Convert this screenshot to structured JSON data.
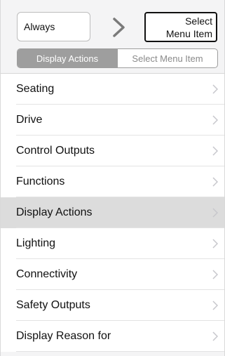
{
  "header": {
    "source_value": "Always",
    "target_line1": "Select",
    "target_line2": "Menu Item"
  },
  "segmented": {
    "options": [
      {
        "label": "Display Actions",
        "active": true
      },
      {
        "label": "Select Menu Item",
        "active": false
      }
    ]
  },
  "menu": {
    "items": [
      {
        "label": "Seating",
        "selected": false
      },
      {
        "label": "Drive",
        "selected": false
      },
      {
        "label": "Control Outputs",
        "selected": false
      },
      {
        "label": "Functions",
        "selected": false
      },
      {
        "label": "Display Actions",
        "selected": true
      },
      {
        "label": "Lighting",
        "selected": false
      },
      {
        "label": "Connectivity",
        "selected": false
      },
      {
        "label": "Safety Outputs",
        "selected": false
      },
      {
        "label": "Display Reason for",
        "selected": false
      }
    ]
  },
  "icons": {
    "arrow": "chevron-right-icon",
    "row_disclosure": "chevron-right-icon"
  },
  "colors": {
    "segment_active": "#9e9e9e",
    "row_selected": "#dcdcdc",
    "chevron": "#c7c7cc"
  }
}
